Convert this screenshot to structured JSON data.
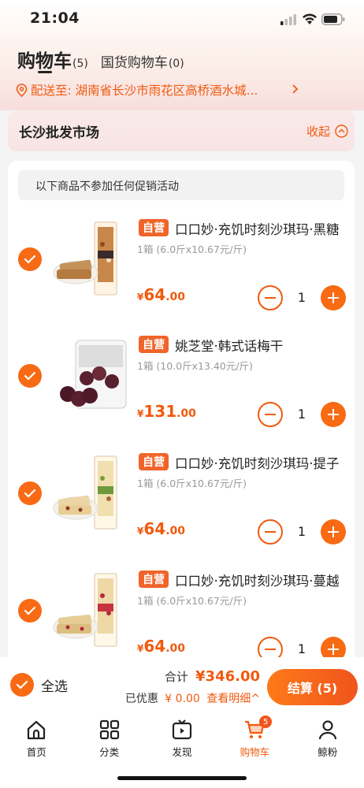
{
  "status_bar": {
    "time": "21:04"
  },
  "header": {
    "tab_cart": "购物车",
    "tab_cart_count": "(5)",
    "tab_national": "国货购物车",
    "tab_national_count": "(0)",
    "address": "配送至: 湖南省长沙市雨花区高桥酒水城..."
  },
  "market": {
    "title": "长沙批发市场",
    "collapse_label": "收起"
  },
  "notice": "以下商品不参加任何促销活动",
  "items": [
    {
      "badge": "自营",
      "name": "口口妙·充饥时刻沙琪玛·黑糖",
      "spec": "1箱 (6.0斤x10.67元/斤)",
      "currency": "¥",
      "price_int": "64",
      "price_dec": ".00",
      "qty": "1"
    },
    {
      "badge": "自营",
      "name": "姚芝堂·韩式话梅干",
      "spec": "1箱 (10.0斤x13.40元/斤)",
      "currency": "¥",
      "price_int": "131",
      "price_dec": ".00",
      "qty": "1"
    },
    {
      "badge": "自营",
      "name": "口口妙·充饥时刻沙琪玛·提子",
      "spec": "1箱 (6.0斤x10.67元/斤)",
      "currency": "¥",
      "price_int": "64",
      "price_dec": ".00",
      "qty": "1"
    },
    {
      "badge": "自营",
      "name": "口口妙·充饥时刻沙琪玛·蔓越",
      "spec": "1箱 (6.0斤x10.67元/斤)",
      "currency": "¥",
      "price_int": "64",
      "price_dec": ".00",
      "qty": "1"
    }
  ],
  "footer": {
    "select_all": "全选",
    "total_label": "合计",
    "total_amount": "¥346.00",
    "discount_label": "已优惠",
    "discount_value": "¥ 0.00",
    "details_link": "查看明细^",
    "checkout": "结算 (5)"
  },
  "nav": [
    {
      "label": "首页",
      "icon": "home-icon"
    },
    {
      "label": "分类",
      "icon": "category-icon"
    },
    {
      "label": "发现",
      "icon": "discover-tv-icon"
    },
    {
      "label": "购物车",
      "icon": "cart-icon",
      "badge": "5",
      "active": true
    },
    {
      "label": "鲸粉",
      "icon": "person-icon"
    }
  ],
  "colors": {
    "accent": "#f05a0f",
    "checkbox": "#f86a14"
  }
}
